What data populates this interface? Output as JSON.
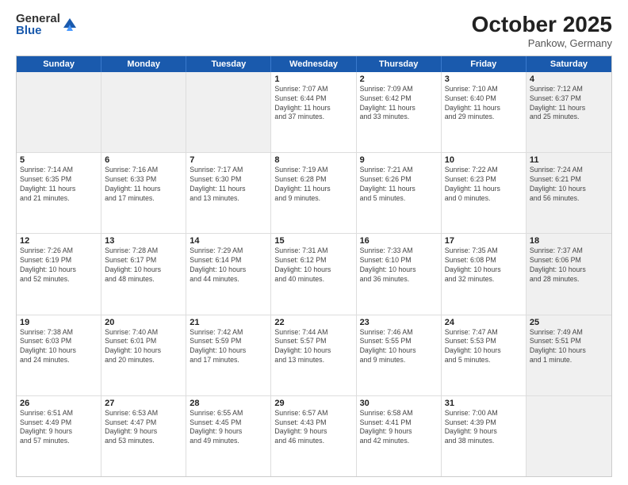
{
  "logo": {
    "general": "General",
    "blue": "Blue"
  },
  "title": "October 2025",
  "location": "Pankow, Germany",
  "header_days": [
    "Sunday",
    "Monday",
    "Tuesday",
    "Wednesday",
    "Thursday",
    "Friday",
    "Saturday"
  ],
  "rows": [
    [
      {
        "day": "",
        "info": "",
        "shaded": true
      },
      {
        "day": "",
        "info": "",
        "shaded": true
      },
      {
        "day": "",
        "info": "",
        "shaded": true
      },
      {
        "day": "1",
        "info": "Sunrise: 7:07 AM\nSunset: 6:44 PM\nDaylight: 11 hours\nand 37 minutes."
      },
      {
        "day": "2",
        "info": "Sunrise: 7:09 AM\nSunset: 6:42 PM\nDaylight: 11 hours\nand 33 minutes."
      },
      {
        "day": "3",
        "info": "Sunrise: 7:10 AM\nSunset: 6:40 PM\nDaylight: 11 hours\nand 29 minutes."
      },
      {
        "day": "4",
        "info": "Sunrise: 7:12 AM\nSunset: 6:37 PM\nDaylight: 11 hours\nand 25 minutes.",
        "shaded": true
      }
    ],
    [
      {
        "day": "5",
        "info": "Sunrise: 7:14 AM\nSunset: 6:35 PM\nDaylight: 11 hours\nand 21 minutes."
      },
      {
        "day": "6",
        "info": "Sunrise: 7:16 AM\nSunset: 6:33 PM\nDaylight: 11 hours\nand 17 minutes."
      },
      {
        "day": "7",
        "info": "Sunrise: 7:17 AM\nSunset: 6:30 PM\nDaylight: 11 hours\nand 13 minutes."
      },
      {
        "day": "8",
        "info": "Sunrise: 7:19 AM\nSunset: 6:28 PM\nDaylight: 11 hours\nand 9 minutes."
      },
      {
        "day": "9",
        "info": "Sunrise: 7:21 AM\nSunset: 6:26 PM\nDaylight: 11 hours\nand 5 minutes."
      },
      {
        "day": "10",
        "info": "Sunrise: 7:22 AM\nSunset: 6:23 PM\nDaylight: 11 hours\nand 0 minutes."
      },
      {
        "day": "11",
        "info": "Sunrise: 7:24 AM\nSunset: 6:21 PM\nDaylight: 10 hours\nand 56 minutes.",
        "shaded": true
      }
    ],
    [
      {
        "day": "12",
        "info": "Sunrise: 7:26 AM\nSunset: 6:19 PM\nDaylight: 10 hours\nand 52 minutes."
      },
      {
        "day": "13",
        "info": "Sunrise: 7:28 AM\nSunset: 6:17 PM\nDaylight: 10 hours\nand 48 minutes."
      },
      {
        "day": "14",
        "info": "Sunrise: 7:29 AM\nSunset: 6:14 PM\nDaylight: 10 hours\nand 44 minutes."
      },
      {
        "day": "15",
        "info": "Sunrise: 7:31 AM\nSunset: 6:12 PM\nDaylight: 10 hours\nand 40 minutes."
      },
      {
        "day": "16",
        "info": "Sunrise: 7:33 AM\nSunset: 6:10 PM\nDaylight: 10 hours\nand 36 minutes."
      },
      {
        "day": "17",
        "info": "Sunrise: 7:35 AM\nSunset: 6:08 PM\nDaylight: 10 hours\nand 32 minutes."
      },
      {
        "day": "18",
        "info": "Sunrise: 7:37 AM\nSunset: 6:06 PM\nDaylight: 10 hours\nand 28 minutes.",
        "shaded": true
      }
    ],
    [
      {
        "day": "19",
        "info": "Sunrise: 7:38 AM\nSunset: 6:03 PM\nDaylight: 10 hours\nand 24 minutes."
      },
      {
        "day": "20",
        "info": "Sunrise: 7:40 AM\nSunset: 6:01 PM\nDaylight: 10 hours\nand 20 minutes."
      },
      {
        "day": "21",
        "info": "Sunrise: 7:42 AM\nSunset: 5:59 PM\nDaylight: 10 hours\nand 17 minutes."
      },
      {
        "day": "22",
        "info": "Sunrise: 7:44 AM\nSunset: 5:57 PM\nDaylight: 10 hours\nand 13 minutes."
      },
      {
        "day": "23",
        "info": "Sunrise: 7:46 AM\nSunset: 5:55 PM\nDaylight: 10 hours\nand 9 minutes."
      },
      {
        "day": "24",
        "info": "Sunrise: 7:47 AM\nSunset: 5:53 PM\nDaylight: 10 hours\nand 5 minutes."
      },
      {
        "day": "25",
        "info": "Sunrise: 7:49 AM\nSunset: 5:51 PM\nDaylight: 10 hours\nand 1 minute.",
        "shaded": true
      }
    ],
    [
      {
        "day": "26",
        "info": "Sunrise: 6:51 AM\nSunset: 4:49 PM\nDaylight: 9 hours\nand 57 minutes."
      },
      {
        "day": "27",
        "info": "Sunrise: 6:53 AM\nSunset: 4:47 PM\nDaylight: 9 hours\nand 53 minutes."
      },
      {
        "day": "28",
        "info": "Sunrise: 6:55 AM\nSunset: 4:45 PM\nDaylight: 9 hours\nand 49 minutes."
      },
      {
        "day": "29",
        "info": "Sunrise: 6:57 AM\nSunset: 4:43 PM\nDaylight: 9 hours\nand 46 minutes."
      },
      {
        "day": "30",
        "info": "Sunrise: 6:58 AM\nSunset: 4:41 PM\nDaylight: 9 hours\nand 42 minutes."
      },
      {
        "day": "31",
        "info": "Sunrise: 7:00 AM\nSunset: 4:39 PM\nDaylight: 9 hours\nand 38 minutes."
      },
      {
        "day": "",
        "info": "",
        "shaded": true
      }
    ]
  ]
}
